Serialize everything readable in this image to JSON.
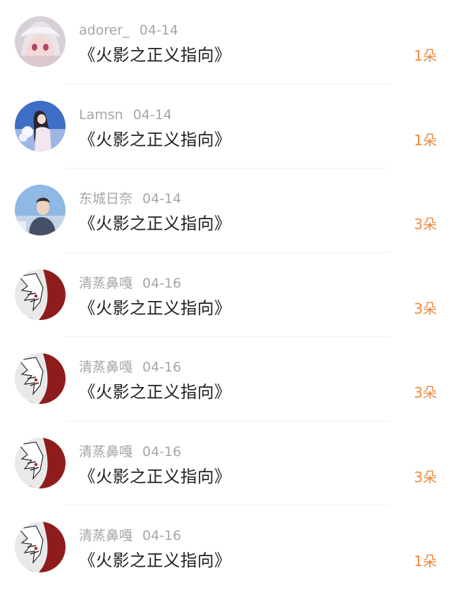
{
  "records": [
    {
      "username": "adorer_",
      "date": "04-14",
      "gift": "《火影之正义指向》",
      "count": "1朵",
      "avatar": "anime-girl-avatar"
    },
    {
      "username": "Lamsn",
      "date": "04-14",
      "gift": "《火影之正义指向》",
      "count": "1朵",
      "avatar": "girl-flowers-avatar"
    },
    {
      "username": "东城日奈",
      "date": "04-14",
      "gift": "《火影之正义指向》",
      "count": "3朵",
      "avatar": "boy-sky-avatar"
    },
    {
      "username": "清蒸鼻嘎",
      "date": "04-16",
      "gift": "《火影之正义指向》",
      "count": "3朵",
      "avatar": "anime-red-avatar"
    },
    {
      "username": "清蒸鼻嘎",
      "date": "04-16",
      "gift": "《火影之正义指向》",
      "count": "3朵",
      "avatar": "anime-red-avatar"
    },
    {
      "username": "清蒸鼻嘎",
      "date": "04-16",
      "gift": "《火影之正义指向》",
      "count": "3朵",
      "avatar": "anime-red-avatar"
    },
    {
      "username": "清蒸鼻嘎",
      "date": "04-16",
      "gift": "《火影之正义指向》",
      "count": "1朵",
      "avatar": "anime-red-avatar"
    }
  ],
  "colors": {
    "count": "#f08a3c",
    "meta": "#a6a6a6",
    "title": "#1f1f1f"
  }
}
